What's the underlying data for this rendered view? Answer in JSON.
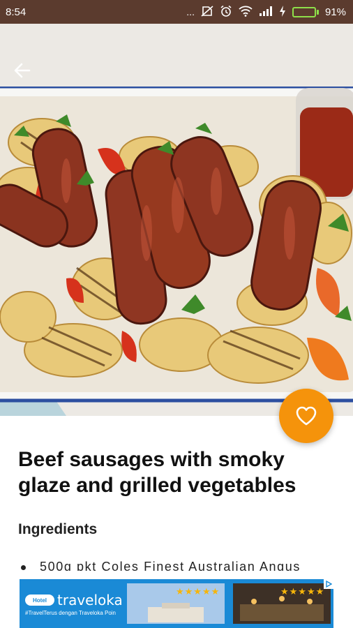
{
  "status_bar": {
    "time": "8:54",
    "dots": "...",
    "battery_percent": "91%",
    "battery_level": 0.91,
    "icons": [
      "no-sim-icon",
      "alarm-icon",
      "wifi-icon",
      "signal-icon",
      "charging-icon",
      "battery-icon"
    ]
  },
  "recipe": {
    "title": "Beef sausages with smoky glaze and grilled vegetables",
    "ingredients_heading": "Ingredients",
    "ingredients": [
      "500g pkt Coles Finest Australian Angus"
    ]
  },
  "ad": {
    "badge": "Hotel",
    "brand": "traveloka",
    "tagline": "#TravelTerus dengan Traveloka Poin",
    "stars_1": "★★★★★",
    "stars_2": "★★★★★"
  },
  "colors": {
    "status_bar": "#5b3b2e",
    "accent": "#f5930b",
    "ad_blue": "#1a8ad6"
  }
}
